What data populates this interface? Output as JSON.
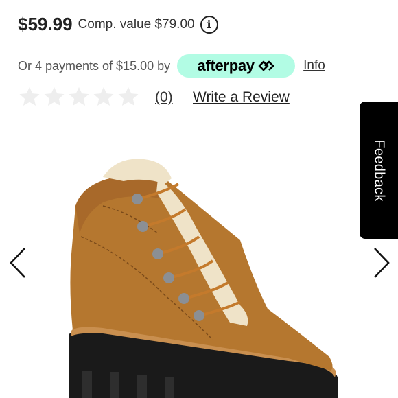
{
  "price": {
    "current": "$59.99",
    "comp_label": "Comp. value $79.00",
    "info_glyph": "i"
  },
  "payments": {
    "text": "Or 4 payments of $15.00 by",
    "provider": "afterpay",
    "badge_color": "#b2fce4",
    "info_link": "Info"
  },
  "rating": {
    "stars_filled": 0,
    "stars_total": 5,
    "count_label": "(0)",
    "write_review": "Write a Review"
  },
  "feedback": {
    "label": "Feedback"
  },
  "carousel": {
    "prev_icon": "chevron-left-icon",
    "next_icon": "chevron-right-icon"
  },
  "product_image": {
    "subject": "tan suede hiking boot with shearling trim"
  }
}
